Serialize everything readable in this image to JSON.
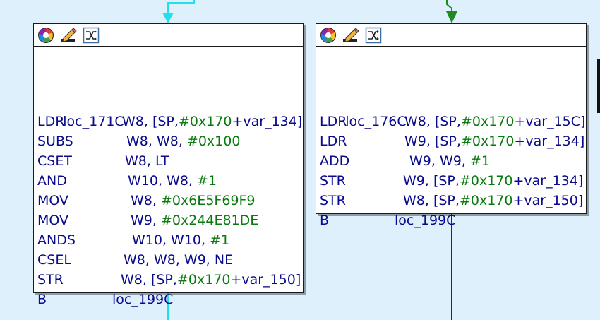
{
  "colors": {
    "background": "#ddf0fc",
    "cyan_edge": "#21e2ec",
    "green_edge": "#1f8a1f",
    "blue_edge": "#1a1ab8",
    "mnemonic": "#0a0a8c",
    "number": "#0a7a10"
  },
  "icons": [
    "color-wheel-icon",
    "rename-pencil-icon",
    "group-nodes-icon"
  ],
  "blocks": [
    {
      "label": "loc_171C",
      "lines": [
        {
          "mnemonic": "LDR",
          "operands": [
            {
              "t": "W8, [SP,",
              "c": "lbl"
            },
            {
              "t": "#0x170",
              "c": "num"
            },
            {
              "t": "+var_134]",
              "c": "lbl"
            }
          ]
        },
        {
          "mnemonic": "SUBS",
          "operands": [
            {
              "t": "W8, W8, ",
              "c": "lbl"
            },
            {
              "t": "#0x100",
              "c": "num"
            }
          ]
        },
        {
          "mnemonic": "CSET",
          "operands": [
            {
              "t": "W8, LT",
              "c": "lbl"
            }
          ]
        },
        {
          "mnemonic": "AND",
          "operands": [
            {
              "t": "W10, W8, ",
              "c": "lbl"
            },
            {
              "t": "#1",
              "c": "num"
            }
          ]
        },
        {
          "mnemonic": "MOV",
          "operands": [
            {
              "t": "W8, ",
              "c": "lbl"
            },
            {
              "t": "#0x6E5F69F9",
              "c": "num"
            }
          ]
        },
        {
          "mnemonic": "MOV",
          "operands": [
            {
              "t": "W9, ",
              "c": "lbl"
            },
            {
              "t": "#0x244E81DE",
              "c": "num"
            }
          ]
        },
        {
          "mnemonic": "ANDS",
          "operands": [
            {
              "t": "W10, W10, ",
              "c": "lbl"
            },
            {
              "t": "#1",
              "c": "num"
            }
          ]
        },
        {
          "mnemonic": "CSEL",
          "operands": [
            {
              "t": "W8, W8, W9, NE",
              "c": "lbl"
            }
          ]
        },
        {
          "mnemonic": "STR",
          "operands": [
            {
              "t": "W8, [SP,",
              "c": "lbl"
            },
            {
              "t": "#0x170",
              "c": "num"
            },
            {
              "t": "+var_150]",
              "c": "lbl"
            }
          ]
        },
        {
          "mnemonic": "B",
          "operands": [
            {
              "t": "loc_199C",
              "c": "lbl"
            }
          ]
        }
      ]
    },
    {
      "label": "loc_176C",
      "lines": [
        {
          "mnemonic": "LDR",
          "operands": [
            {
              "t": "W8, [SP,",
              "c": "lbl"
            },
            {
              "t": "#0x170",
              "c": "num"
            },
            {
              "t": "+var_15C]",
              "c": "lbl"
            }
          ]
        },
        {
          "mnemonic": "LDR",
          "operands": [
            {
              "t": "W9, [SP,",
              "c": "lbl"
            },
            {
              "t": "#0x170",
              "c": "num"
            },
            {
              "t": "+var_134]",
              "c": "lbl"
            }
          ]
        },
        {
          "mnemonic": "ADD",
          "operands": [
            {
              "t": "W9, W9, ",
              "c": "lbl"
            },
            {
              "t": "#1",
              "c": "num"
            }
          ]
        },
        {
          "mnemonic": "STR",
          "operands": [
            {
              "t": "W9, [SP,",
              "c": "lbl"
            },
            {
              "t": "#0x170",
              "c": "num"
            },
            {
              "t": "+var_134]",
              "c": "lbl"
            }
          ]
        },
        {
          "mnemonic": "STR",
          "operands": [
            {
              "t": "W8, [SP,",
              "c": "lbl"
            },
            {
              "t": "#0x170",
              "c": "num"
            },
            {
              "t": "+var_150]",
              "c": "lbl"
            }
          ]
        },
        {
          "mnemonic": "B",
          "operands": [
            {
              "t": "loc_199C",
              "c": "lbl"
            }
          ]
        }
      ]
    }
  ]
}
